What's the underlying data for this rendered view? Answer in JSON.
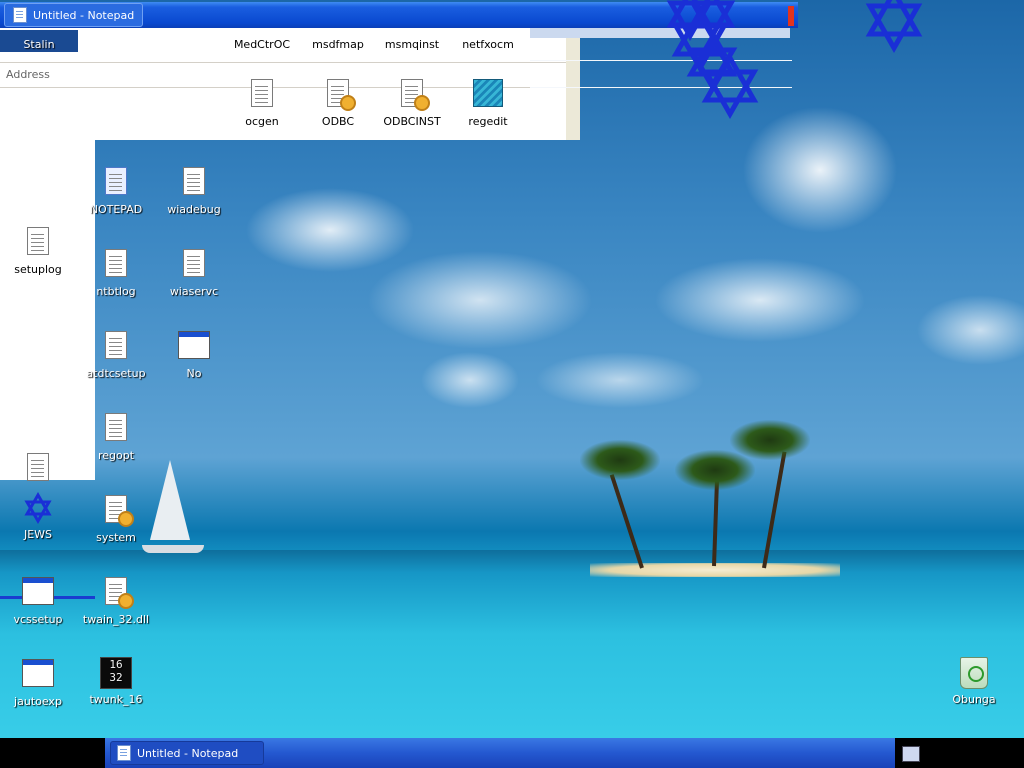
{
  "top_window": {
    "title": "Untitled - Notepad"
  },
  "explorer": {
    "address_label": "Address",
    "top_row_labels": [
      "Stalin",
      "MedCtrOC",
      "msdfmap",
      "msmqinst",
      "netfxocm"
    ],
    "files": [
      {
        "label": "ocgen",
        "icon": "text-document-icon"
      },
      {
        "label": "ODBC",
        "icon": "settings-document-icon"
      },
      {
        "label": "ODBCINST",
        "icon": "settings-document-icon"
      },
      {
        "label": "regedit",
        "icon": "registry-editor-icon"
      }
    ]
  },
  "desktop_icons": [
    {
      "label": "NOTEPAD",
      "icon": "notepad-icon"
    },
    {
      "label": "wiadebug",
      "icon": "text-document-icon"
    },
    {
      "label": "setuplog",
      "icon": "text-document-icon"
    },
    {
      "label": "ntbtlog",
      "icon": "text-document-icon"
    },
    {
      "label": "wiaservc",
      "icon": "text-document-icon"
    },
    {
      "label": "atdtcsetup",
      "icon": "text-document-icon"
    },
    {
      "label": "No",
      "icon": "application-window-icon"
    },
    {
      "label": "regopt",
      "icon": "text-document-icon"
    },
    {
      "label": "JEWS",
      "icon": "star-of-david-icon"
    },
    {
      "label": "system",
      "icon": "settings-document-icon"
    },
    {
      "label": "vcssetup",
      "icon": "setup-program-icon"
    },
    {
      "label": "twain_32.dll",
      "icon": "dll-file-icon"
    },
    {
      "label": "jautoexp",
      "icon": "application-window-icon"
    },
    {
      "label": "twunk_16",
      "icon": "twunk-16-icon"
    },
    {
      "label": "Obunga",
      "icon": "recycle-bin-icon"
    }
  ],
  "twunk_icon_text": [
    "16",
    "32"
  ],
  "taskbar": {
    "task_label": "Untitled - Notepad"
  },
  "colors": {
    "star_blue": "#1a2fd6",
    "taskbar_blue": "#2458d0"
  }
}
